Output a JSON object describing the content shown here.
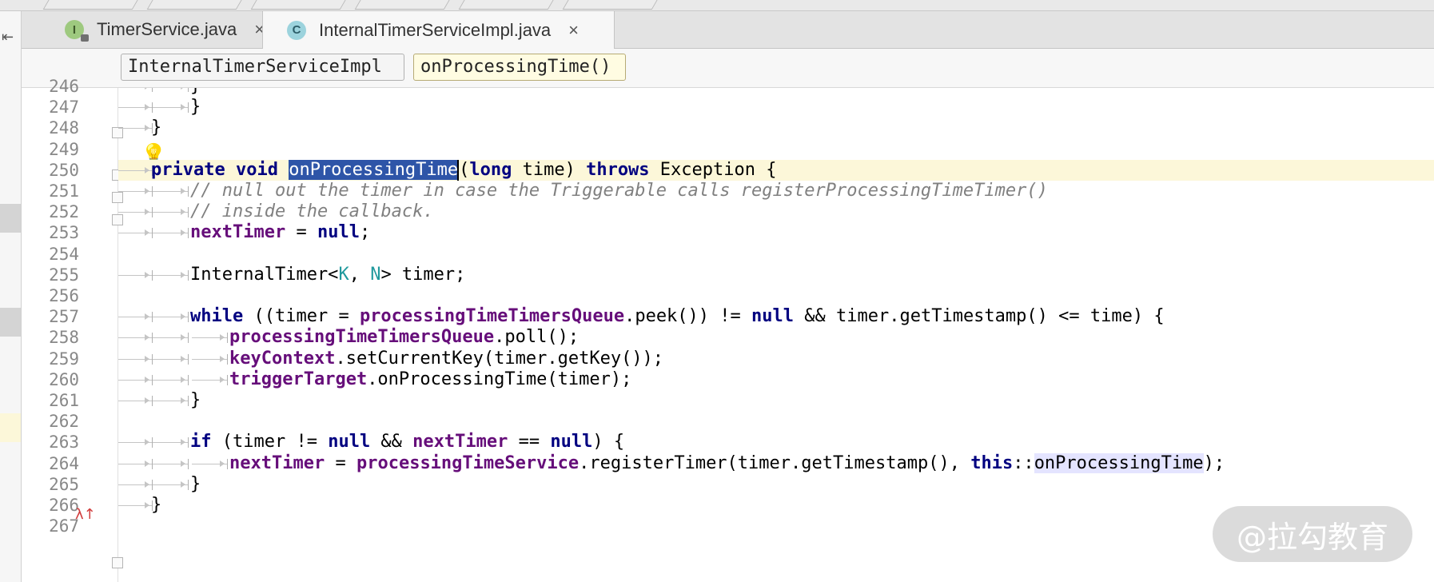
{
  "tabs": [
    {
      "icon_letter": "I",
      "icon_name": "interface-icon",
      "label": "TimerService.java",
      "close": "×",
      "active": false
    },
    {
      "icon_letter": "C",
      "icon_name": "class-icon",
      "label": "InternalTimerServiceImpl.java",
      "close": "×",
      "active": true
    }
  ],
  "breadcrumb": {
    "class_name": "InternalTimerServiceImpl",
    "method_name": "onProcessingTime()"
  },
  "editor": {
    "current_line": 250,
    "line_numbers": [
      "246",
      "247",
      "248",
      "249",
      "250",
      "251",
      "252",
      "253",
      "254",
      "255",
      "256",
      "257",
      "258",
      "259",
      "260",
      "261",
      "262",
      "263",
      "264",
      "265",
      "266",
      "267"
    ],
    "lines": [
      {
        "n": "246",
        "segments": [
          {
            "t": "}",
            "c": "p"
          }
        ]
      },
      {
        "n": "247",
        "segments": [
          {
            "t": "}",
            "c": "p"
          }
        ]
      },
      {
        "n": "248",
        "segments": [
          {
            "t": "}",
            "c": "p"
          }
        ]
      },
      {
        "n": "249",
        "segments": []
      },
      {
        "n": "250",
        "segments": [
          {
            "t": "private",
            "c": "kw"
          },
          {
            "t": " ",
            "c": "p"
          },
          {
            "t": "void",
            "c": "kw"
          },
          {
            "t": " ",
            "c": "p"
          },
          {
            "t": "onProcessingTime",
            "c": "sel"
          },
          {
            "t": "(",
            "c": "p"
          },
          {
            "t": "long",
            "c": "kw"
          },
          {
            "t": " time) ",
            "c": "p"
          },
          {
            "t": "throws",
            "c": "kw"
          },
          {
            "t": " Exception {",
            "c": "p"
          }
        ]
      },
      {
        "n": "251",
        "segments": [
          {
            "t": "// null out the timer in case the Triggerable calls registerProcessingTimeTimer()",
            "c": "cmt"
          }
        ]
      },
      {
        "n": "252",
        "segments": [
          {
            "t": "// inside the callback.",
            "c": "cmt"
          }
        ]
      },
      {
        "n": "253",
        "segments": [
          {
            "t": "nextTimer",
            "c": "fld"
          },
          {
            "t": " = ",
            "c": "p"
          },
          {
            "t": "null",
            "c": "kw"
          },
          {
            "t": ";",
            "c": "p"
          }
        ]
      },
      {
        "n": "254",
        "segments": []
      },
      {
        "n": "255",
        "segments": [
          {
            "t": "InternalTimer<",
            "c": "p"
          },
          {
            "t": "K",
            "c": "gen"
          },
          {
            "t": ", ",
            "c": "p"
          },
          {
            "t": "N",
            "c": "gen"
          },
          {
            "t": "> timer;",
            "c": "p"
          }
        ]
      },
      {
        "n": "256",
        "segments": []
      },
      {
        "n": "257",
        "segments": [
          {
            "t": "while",
            "c": "kw"
          },
          {
            "t": " ((timer = ",
            "c": "p"
          },
          {
            "t": "processingTimeTimersQueue",
            "c": "fld"
          },
          {
            "t": ".peek()) != ",
            "c": "p"
          },
          {
            "t": "null",
            "c": "kw"
          },
          {
            "t": " && timer.getTimestamp() <= time) {",
            "c": "p"
          }
        ]
      },
      {
        "n": "258",
        "segments": [
          {
            "t": "processingTimeTimersQueue",
            "c": "fld"
          },
          {
            "t": ".poll();",
            "c": "p"
          }
        ]
      },
      {
        "n": "259",
        "segments": [
          {
            "t": "keyContext",
            "c": "fld"
          },
          {
            "t": ".setCurrentKey(timer.getKey());",
            "c": "p"
          }
        ]
      },
      {
        "n": "260",
        "segments": [
          {
            "t": "triggerTarget",
            "c": "fld"
          },
          {
            "t": ".onProcessingTime(timer);",
            "c": "p"
          }
        ]
      },
      {
        "n": "261",
        "segments": [
          {
            "t": "}",
            "c": "p"
          }
        ]
      },
      {
        "n": "262",
        "segments": []
      },
      {
        "n": "263",
        "segments": [
          {
            "t": "if",
            "c": "kw"
          },
          {
            "t": " (timer != ",
            "c": "p"
          },
          {
            "t": "null",
            "c": "kw"
          },
          {
            "t": " && ",
            "c": "p"
          },
          {
            "t": "nextTimer",
            "c": "fld"
          },
          {
            "t": " == ",
            "c": "p"
          },
          {
            "t": "null",
            "c": "kw"
          },
          {
            "t": ") {",
            "c": "p"
          }
        ]
      },
      {
        "n": "264",
        "segments": [
          {
            "t": "nextTimer",
            "c": "fld"
          },
          {
            "t": " = ",
            "c": "p"
          },
          {
            "t": "processingTimeService",
            "c": "fld"
          },
          {
            "t": ".registerTimer(timer.getTimestamp(), ",
            "c": "p"
          },
          {
            "t": "this",
            "c": "kw"
          },
          {
            "t": "::",
            "c": "p"
          },
          {
            "t": "onProcessingTime",
            "c": "ref"
          },
          {
            "t": ");",
            "c": "p"
          }
        ]
      },
      {
        "n": "265",
        "segments": [
          {
            "t": "}",
            "c": "p"
          }
        ]
      },
      {
        "n": "266",
        "segments": [
          {
            "t": "}",
            "c": "p"
          }
        ]
      },
      {
        "n": "267",
        "segments": []
      }
    ]
  },
  "gutter_icons": {
    "intention_bulb": "lightbulb-icon",
    "line_264_marker": "λ↑"
  },
  "watermark": "@拉勾教育",
  "colors": {
    "keyword": "#000080",
    "field": "#660e7a",
    "comment": "#808080",
    "generic": "#20999d",
    "selection": "#2e55a8",
    "current_line": "#fcf7d9"
  }
}
